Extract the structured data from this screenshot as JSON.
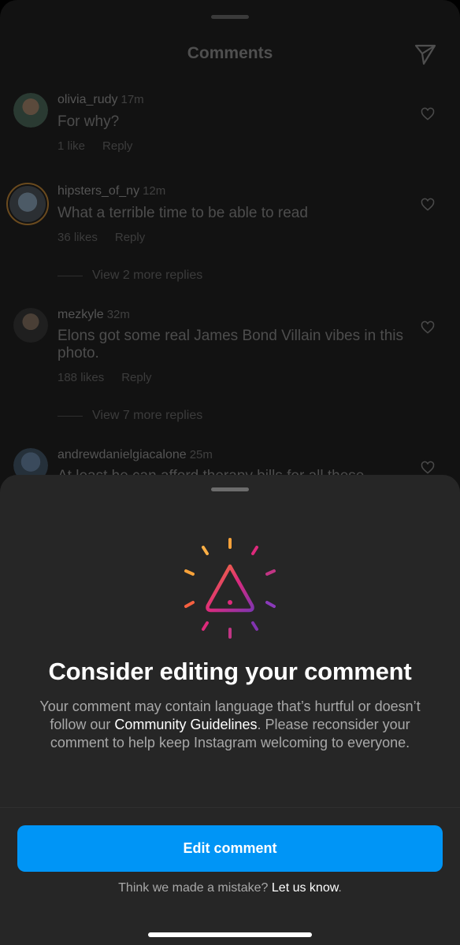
{
  "header": {
    "title": "Comments",
    "send_icon": "send-icon"
  },
  "comments": [
    {
      "username": "olivia_rudy",
      "time": "17m",
      "text": "For why?",
      "likes": "1 like",
      "reply": "Reply"
    },
    {
      "username": "hipsters_of_ny",
      "time": "12m",
      "text": "What a terrible time to be able to read",
      "likes": "36 likes",
      "reply": "Reply",
      "view_replies": "View 2 more replies"
    },
    {
      "username": "mezkyle",
      "time": "32m",
      "text": "Elons got some real James Bond Villain vibes in this photo.",
      "likes": "188 likes",
      "reply": "Reply",
      "view_replies": "View 7 more replies"
    },
    {
      "username": "andrewdanielgiacalone",
      "time": "25m",
      "text": "At least he can afford therapy bills for all these"
    }
  ],
  "sheet": {
    "icon": "warning-triangle-icon",
    "title": "Consider editing your comment",
    "body_before": "Your comment may contain language that’s hurtful or doesn’t follow our ",
    "body_link": "Community Guidelines",
    "body_after": ". Please reconsider your comment to help keep Instagram welcoming to everyone.",
    "edit_button": "Edit comment",
    "mistake_text": "Think we made a mistake? ",
    "mistake_link": "Let us know",
    "mistake_end": "."
  },
  "colors": {
    "accent": "#0095f6",
    "sheet_bg": "#262626"
  }
}
